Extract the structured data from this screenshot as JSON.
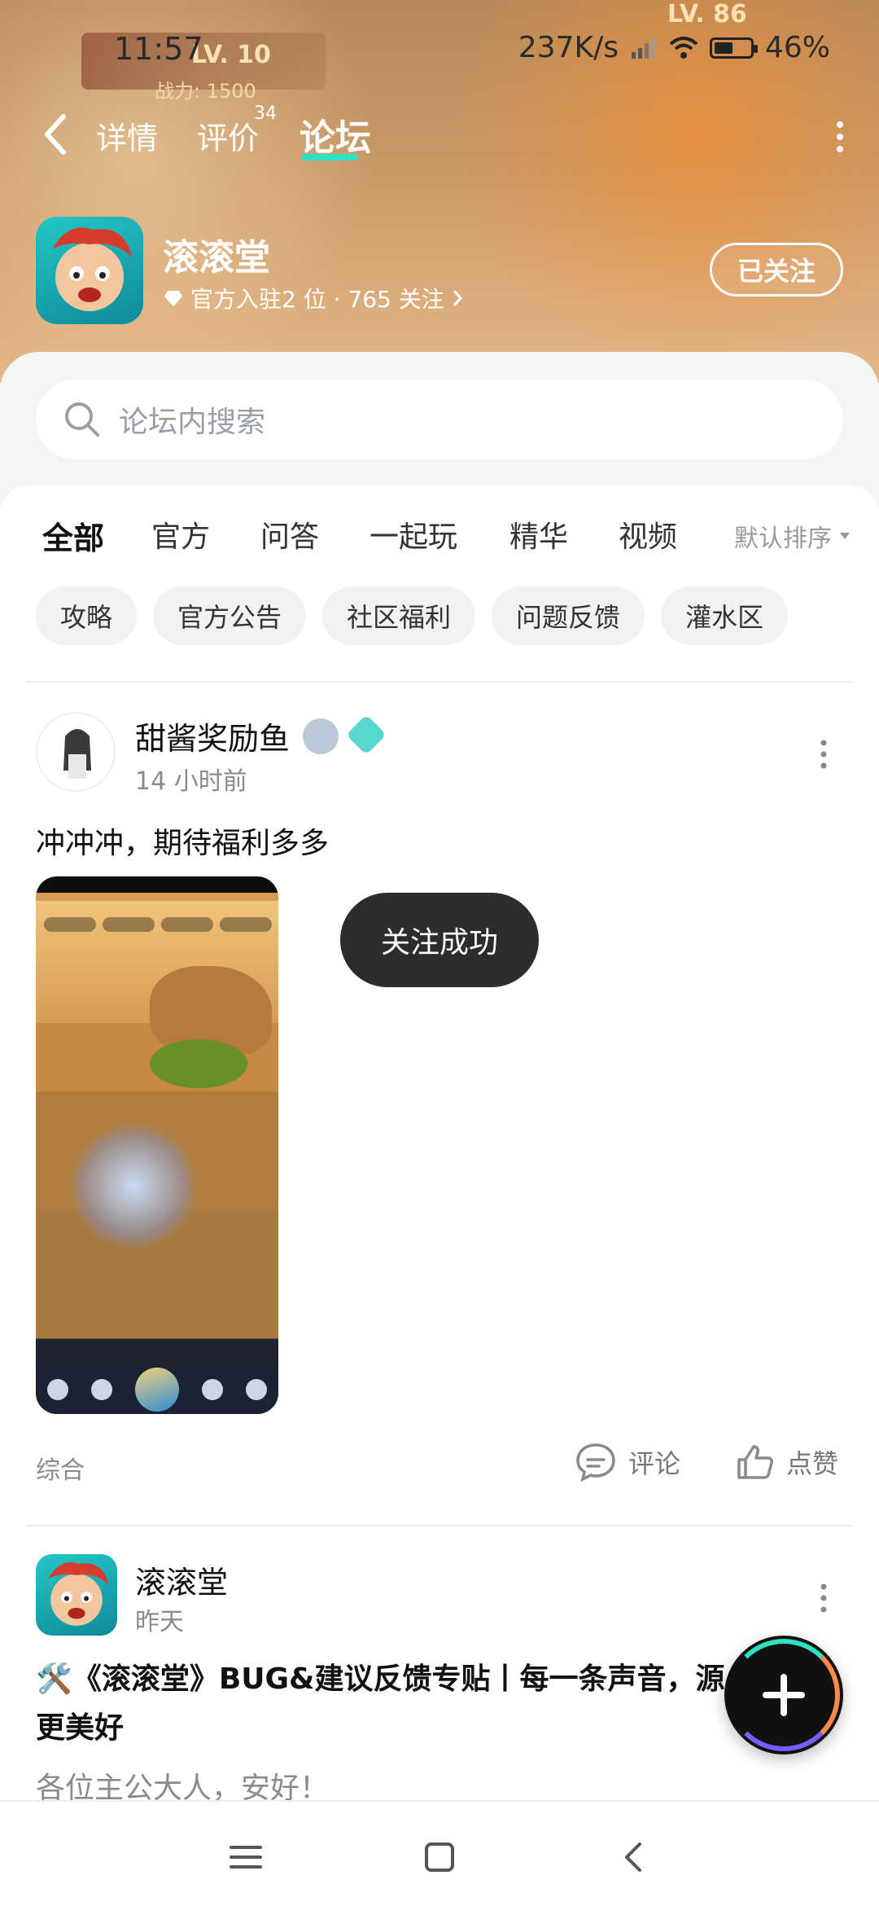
{
  "status_bar": {
    "time": "11:57",
    "network_speed": "237K/s",
    "battery": "46%",
    "battery_level": 0.46
  },
  "game_art": {
    "level_left": "LV. 10",
    "power": "战力: 1500",
    "level_right": "LV. 86"
  },
  "nav": {
    "back_icon": "chevron-left-icon",
    "tabs": [
      {
        "label": "详情"
      },
      {
        "label": "评价",
        "count": "34"
      },
      {
        "label": "论坛",
        "active": true
      }
    ],
    "more_icon": "more-vertical-icon"
  },
  "app": {
    "name": "滚滚堂",
    "meta": "官方入驻2 位 · 765 关注",
    "follow_label": "已关注"
  },
  "search": {
    "placeholder": "论坛内搜索"
  },
  "tabs": {
    "items": [
      "全部",
      "官方",
      "问答",
      "一起玩",
      "精华",
      "视频"
    ],
    "active": "全部",
    "sort_label": "默认排序"
  },
  "chips": [
    "攻略",
    "官方公告",
    "社区福利",
    "问题反馈",
    "灌水区"
  ],
  "posts": [
    {
      "author": "甜酱奖励鱼",
      "time": "14 小时前",
      "content": "冲冲冲，期待福利多多",
      "category": "综合",
      "comment_label": "评论",
      "like_label": "点赞"
    },
    {
      "author": "滚滚堂",
      "time": "昨天",
      "title": "🛠️《滚滚堂》BUG&建议反馈专贴丨每一条声音，源更美好",
      "excerpt": "各位主公大人，安好！"
    }
  ],
  "toast": {
    "text": "关注成功"
  },
  "colors": {
    "accent": "#2fe0c2",
    "toast_bg": "#2c2c2c",
    "header_bg": "#c79866"
  }
}
